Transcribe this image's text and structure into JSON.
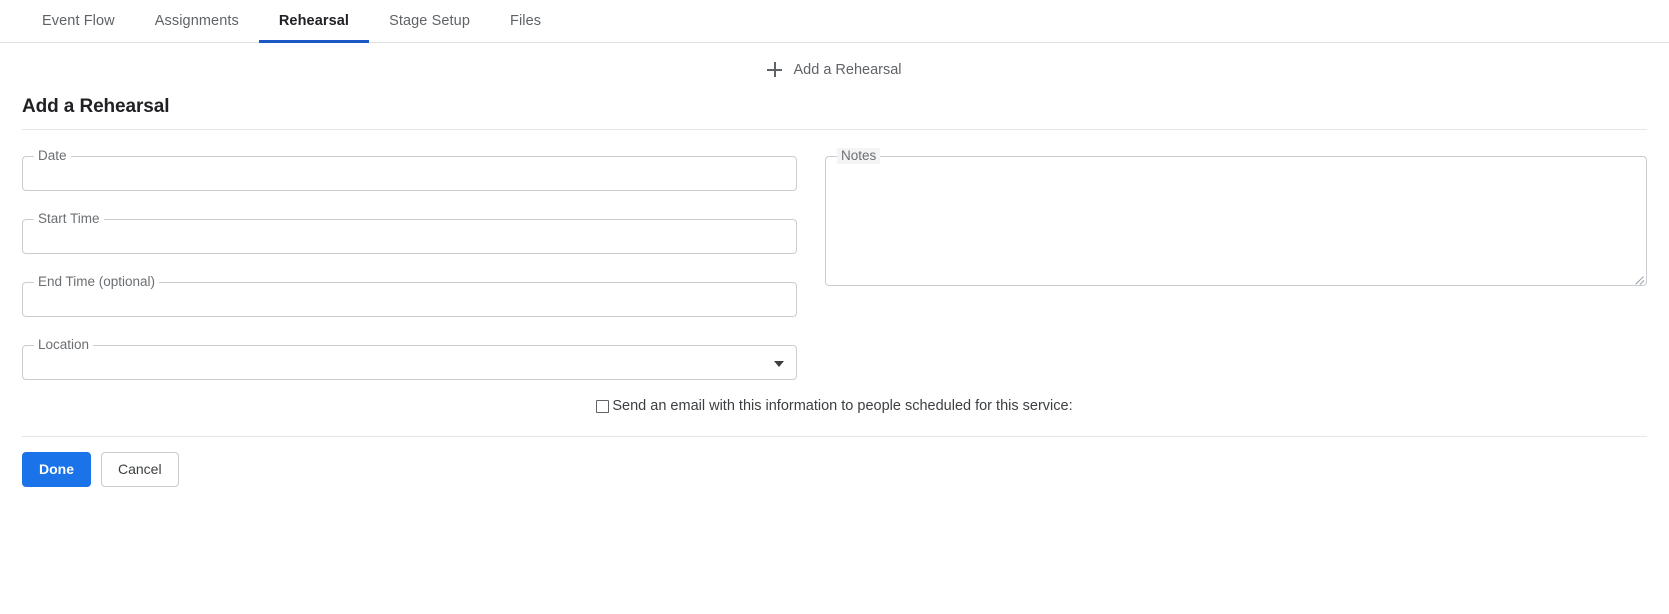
{
  "tabs": [
    {
      "label": "Event Flow",
      "active": false
    },
    {
      "label": "Assignments",
      "active": false
    },
    {
      "label": "Rehearsal",
      "active": true
    },
    {
      "label": "Stage Setup",
      "active": false
    },
    {
      "label": "Files",
      "active": false
    }
  ],
  "add_link": {
    "label": "Add a Rehearsal",
    "icon": "plus-icon"
  },
  "section": {
    "title": "Add a Rehearsal"
  },
  "fields": {
    "date": {
      "label": "Date",
      "value": "",
      "placeholder": ""
    },
    "start_time": {
      "label": "Start Time",
      "value": "",
      "placeholder": ""
    },
    "end_time": {
      "label": "End Time (optional)",
      "value": "",
      "placeholder": ""
    },
    "location": {
      "label": "Location",
      "value": "",
      "caret_icon": "chevron-down-icon"
    },
    "notes": {
      "label": "Notes",
      "value": "",
      "placeholder": ""
    }
  },
  "checkbox": {
    "label": "Send an email with this information to people scheduled for this service:",
    "checked": false
  },
  "footer": {
    "done_label": "Done",
    "cancel_label": "Cancel"
  },
  "colors": {
    "accent_tab": "#1a56c4",
    "primary_button": "#1a73e8",
    "border": "#c9ccd0",
    "text_muted": "#5f6368",
    "text_dark": "#202124"
  }
}
